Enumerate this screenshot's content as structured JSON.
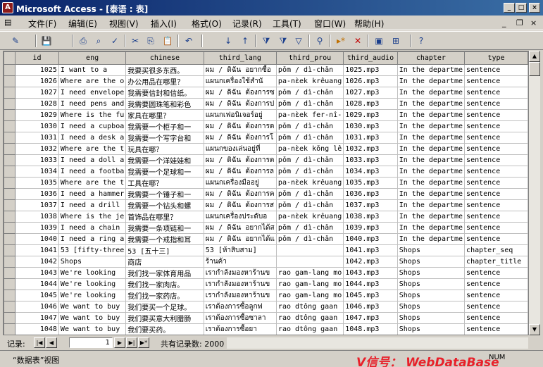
{
  "window": {
    "title": "Microsoft Access - [泰语 : 表]",
    "app_icon_letter": "A"
  },
  "menu": {
    "items": [
      "文件(F)",
      "编辑(E)",
      "视图(V)",
      "插入(I)",
      "格式(O)",
      "记录(R)",
      "工具(T)",
      "窗口(W)",
      "帮助(H)"
    ]
  },
  "grid": {
    "columns": [
      "id",
      "eng",
      "chinese",
      "third_lang",
      "third_prou",
      "third_audio",
      "chapter",
      "type"
    ],
    "rows": [
      [
        "1025",
        "I want to a",
        "我要买很多东西。",
        "ผม / ดิฉัน อยากซื้อ",
        "pǒm / dì-chǎn",
        "1025.mp3",
        "In the departme",
        "sentence"
      ],
      [
        "1026",
        "Where are the o",
        "办公用品在哪里？",
        "แผนกเครื่องใช้สำนั",
        "pa-nὲek krêuang",
        "1026.mp3",
        "In the departme",
        "sentence"
      ],
      [
        "1027",
        "I need envelope",
        "我需要信封和信纸。",
        "ผม / ดิฉัน ต้องการซ",
        "pǒm / dì-chǎn",
        "1027.mp3",
        "In the departme",
        "sentence"
      ],
      [
        "1028",
        "I need pens and",
        "我需要圆珠笔和彩色",
        "ผม / ดิฉัน ต้องการป",
        "pǒm / dì-chǎn",
        "1028.mp3",
        "In the departme",
        "sentence"
      ],
      [
        "1029",
        "Where is the fu",
        "家具在哪里？",
        "แผนกเฟอนิเจอร์อยู่",
        "pa-nὲek fer-nî-",
        "1029.mp3",
        "In the departme",
        "sentence"
      ],
      [
        "1030",
        "I need a cupboa",
        "我需要一个柜子和一",
        "ผม / ดิฉัน ต้องการต",
        "pǒm / dì-chǎn",
        "1030.mp3",
        "In the departme",
        "sentence"
      ],
      [
        "1031",
        "I need a desk a",
        "我需要一个写字台和",
        "ผม / ดิฉัน ต้องการโ",
        "pǒm / dì-chǎn",
        "1031.mp3",
        "In the departme",
        "sentence"
      ],
      [
        "1032",
        "Where are the t",
        "玩具在哪？",
        "แผนกของเล่นอยู่ที่",
        "pa-nὲek kǒng lê",
        "1032.mp3",
        "In the departme",
        "sentence"
      ],
      [
        "1033",
        "I need a doll a",
        "我需要一个洋娃娃和",
        "ผม / ดิฉัน ต้องการต",
        "pǒm / dì-chǎn",
        "1033.mp3",
        "In the departme",
        "sentence"
      ],
      [
        "1034",
        "I need a footba",
        "我需要一个足球和一",
        "ผม / ดิฉัน ต้องการล",
        "pǒm / dì-chǎn",
        "1034.mp3",
        "In the departme",
        "sentence"
      ],
      [
        "1035",
        "Where are the t",
        "工具在哪？",
        "แผนกเครื่องมืออยู่",
        "pa-nὲek krêuang",
        "1035.mp3",
        "In the departme",
        "sentence"
      ],
      [
        "1036",
        "I need a hammer",
        "我需要一个锤子和一",
        "ผม / ดิฉัน ต้องการค",
        "pǒm / dì-chǎn",
        "1036.mp3",
        "In the departme",
        "sentence"
      ],
      [
        "1037",
        "I need a drill",
        "我需要一个钻头和螺",
        "ผม / ดิฉัน ต้องการส",
        "pǒm / dì-chǎn",
        "1037.mp3",
        "In the departme",
        "sentence"
      ],
      [
        "1038",
        "Where is the je",
        "首饰品在哪里？",
        "แผนกเครื่องประดับอ",
        "pa-nὲek krêuang",
        "1038.mp3",
        "In the departme",
        "sentence"
      ],
      [
        "1039",
        "I need a chain",
        "我需要一条项链和一",
        "ผม / ดิฉัน อยากได้ส",
        "pǒm / dì-chǎn",
        "1039.mp3",
        "In the departme",
        "sentence"
      ],
      [
        "1040",
        "I need a ring a",
        "我需要一个戒指和耳",
        "ผม / ดิฉัน อยากได้แ",
        "pǒm / dì-chǎn",
        "1040.mp3",
        "In the departme",
        "sentence"
      ],
      [
        "1041",
        "53 [fifty-three",
        "53 [五十三]",
        "53 [ห้าสิบสาม]",
        "",
        "1041.mp3",
        "Shops",
        "chapter_seq"
      ],
      [
        "1042",
        "Shops",
        "商店",
        "ร้านค้า",
        "",
        "1042.mp3",
        "Shops",
        "chapter_title"
      ],
      [
        "1043",
        "We're looking",
        "我们找一家体育用品",
        "เรากำลังมองหาร้านข",
        "rao gam-lang mo",
        "1043.mp3",
        "Shops",
        "sentence"
      ],
      [
        "1044",
        "We're looking",
        "我们找一家肉店。",
        "เรากำลังมองหาร้านข",
        "rao gam-lang mo",
        "1044.mp3",
        "Shops",
        "sentence"
      ],
      [
        "1045",
        "We're looking",
        "我们找一家药店。",
        "เรากำลังมองหาร้านข",
        "rao gam-lang mo",
        "1045.mp3",
        "Shops",
        "sentence"
      ],
      [
        "1046",
        "We want to buy",
        "我们要买一个足球。",
        "เราต้องการซื้อลูกฟ",
        "rao dtông gaan",
        "1046.mp3",
        "Shops",
        "sentence"
      ],
      [
        "1047",
        "We want to buy",
        "我们要买意大利腊肠",
        "เราต้องการซื้อซาลา",
        "rao dtông gaan",
        "1047.mp3",
        "Shops",
        "sentence"
      ],
      [
        "1048",
        "We want to buy",
        "我们要买药。",
        "เราต้องการซื้อยา",
        "rao dtông gaan",
        "1048.mp3",
        "Shops",
        "sentence"
      ]
    ]
  },
  "navigator": {
    "label": "记录:",
    "current": "1",
    "total_text": "共有记录数: 2000"
  },
  "status": {
    "text": "“数据表”视图",
    "watermark": "V信号： WebDataBase",
    "numlock": "NUM"
  },
  "icons": [
    "pencil-icon",
    "save-icon",
    "print-icon",
    "preview-icon",
    "spell-icon",
    "cut-icon",
    "copy-icon",
    "paste-icon",
    "undo-icon",
    "sort-asc-icon",
    "sort-desc-icon",
    "filter-icon",
    "filter-form-icon",
    "apply-filter-icon",
    "find-icon",
    "new-record-icon",
    "delete-record-icon",
    "database-window-icon",
    "new-object-icon",
    "help-icon"
  ]
}
